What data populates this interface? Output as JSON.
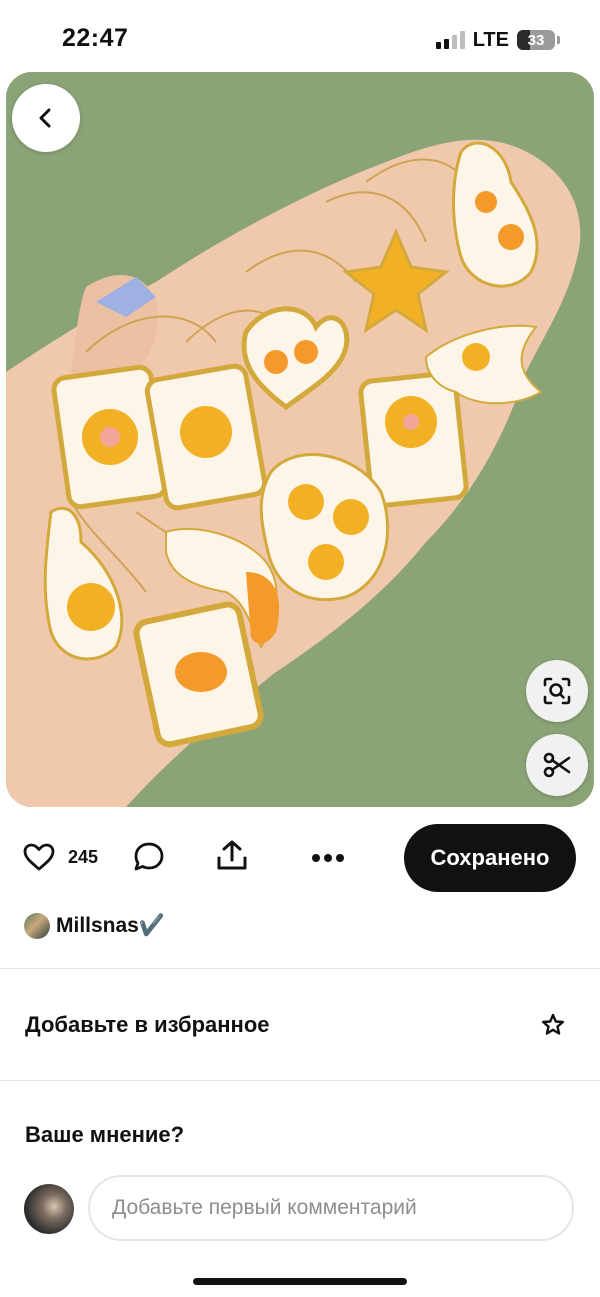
{
  "status_bar": {
    "time": "22:47",
    "network": "LTE",
    "battery": "33",
    "battery_level": 0.33,
    "icons": [
      "signal-icon",
      "battery-icon"
    ]
  },
  "pin": {
    "image_icons": [
      "back-arrow-icon",
      "visual-search-icon",
      "scissors-icon"
    ]
  },
  "actions": {
    "like_count": "245",
    "save_label": "Сохранено",
    "icons": [
      "heart-icon",
      "comment-bubble-icon",
      "share-icon",
      "more-dots-icon"
    ]
  },
  "author": {
    "name": "Millsnas✔️"
  },
  "favorites": {
    "label": "Добавьте в избранное",
    "icon": "star-icon"
  },
  "comments": {
    "title": "Ваше мнение?",
    "placeholder": "Добавьте первый комментарий"
  },
  "colors": {
    "background_green": "#8aa377",
    "pendant_yellow": "#f2b125",
    "pendant_orange": "#f39a2b",
    "gold": "#d4a93c",
    "save_button": "#111111"
  }
}
